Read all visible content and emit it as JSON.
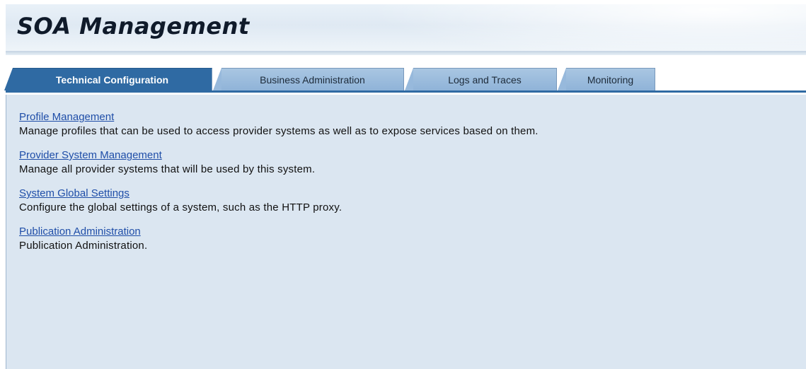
{
  "header": {
    "title": "SOA Management"
  },
  "tabs": [
    {
      "label": "Technical Configuration",
      "active": true
    },
    {
      "label": "Business Administration",
      "active": false
    },
    {
      "label": "Logs and Traces",
      "active": false
    },
    {
      "label": "Monitoring",
      "active": false
    }
  ],
  "entries": [
    {
      "link": "Profile Management",
      "description": "Manage profiles that can be used to access provider systems as well as to expose services based on them."
    },
    {
      "link": "Provider System Management",
      "description": "Manage all provider systems that will be used by this system."
    },
    {
      "link": "System Global Settings",
      "description": "Configure the global settings of a system, such as the HTTP proxy."
    },
    {
      "link": "Publication Administration",
      "description": "Publication Administration."
    }
  ],
  "colors": {
    "active_tab": "#2f6aa3",
    "inactive_tab": "#97b9dc",
    "content_background": "#dbe6f1",
    "link": "#1f4ea8"
  }
}
